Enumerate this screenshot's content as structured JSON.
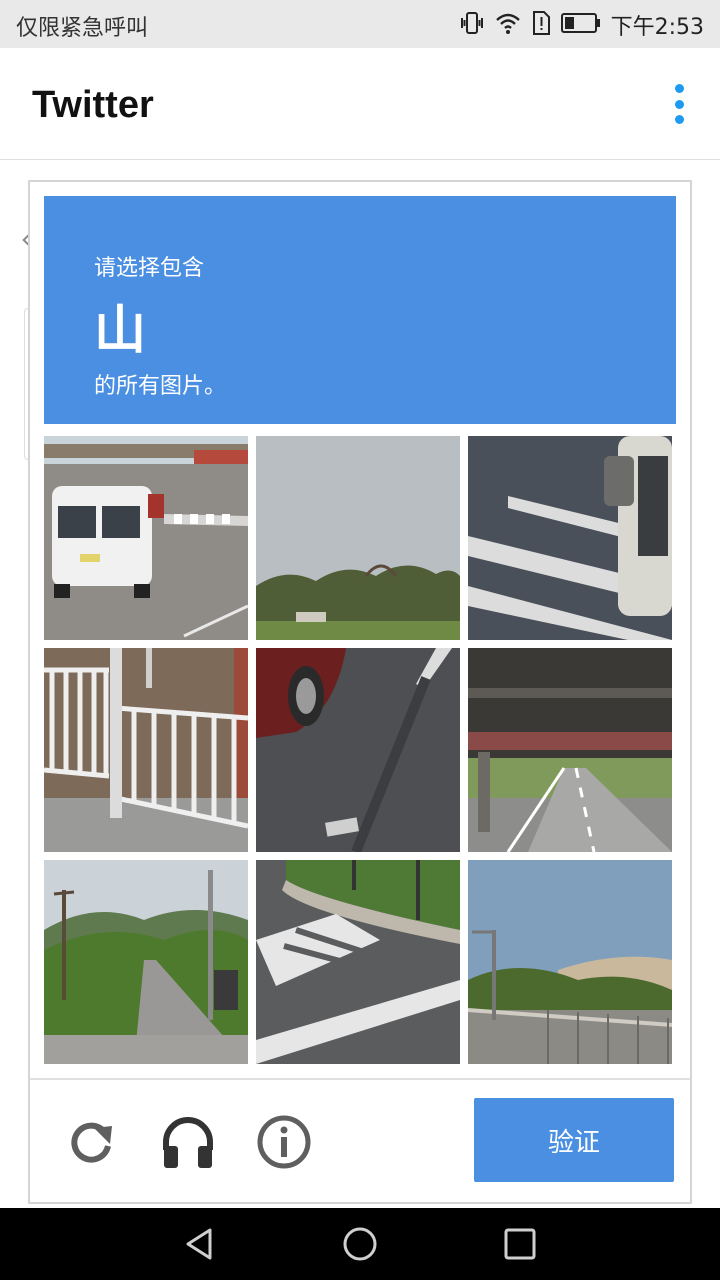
{
  "status_bar": {
    "carrier_text": "仅限紧急呼叫",
    "time": "下午2:53",
    "icons": [
      "vibrate-icon",
      "wifi-icon",
      "sim-alert-icon",
      "battery-icon"
    ]
  },
  "app_bar": {
    "title": "Twitter",
    "menu_icon": "overflow-menu-icon",
    "accent_color": "#1d9bf0"
  },
  "captcha": {
    "prompt": {
      "line1": "请选择包含",
      "keyword": "山",
      "line2": "的所有图片。",
      "background_color": "#4a8fe2"
    },
    "tiles": [
      {
        "id": 1,
        "scene": "white van at street intersection"
      },
      {
        "id": 2,
        "scene": "sky over trees"
      },
      {
        "id": 3,
        "scene": "crosswalk with truck mirror"
      },
      {
        "id": 4,
        "scene": "white metal fence on sidewalk"
      },
      {
        "id": 5,
        "scene": "asphalt with red car edge"
      },
      {
        "id": 6,
        "scene": "road under bridge"
      },
      {
        "id": 7,
        "scene": "rural road with mountains and railroad crossing"
      },
      {
        "id": 8,
        "scene": "crosswalk at curb"
      },
      {
        "id": 9,
        "scene": "hills behind fence"
      }
    ],
    "footer": {
      "reload_icon": "reload-icon",
      "audio_icon": "headphones-icon",
      "info_icon": "info-icon",
      "verify_label": "验证"
    }
  },
  "nav_bar": {
    "icons": [
      "back-icon",
      "home-icon",
      "recents-icon"
    ]
  }
}
